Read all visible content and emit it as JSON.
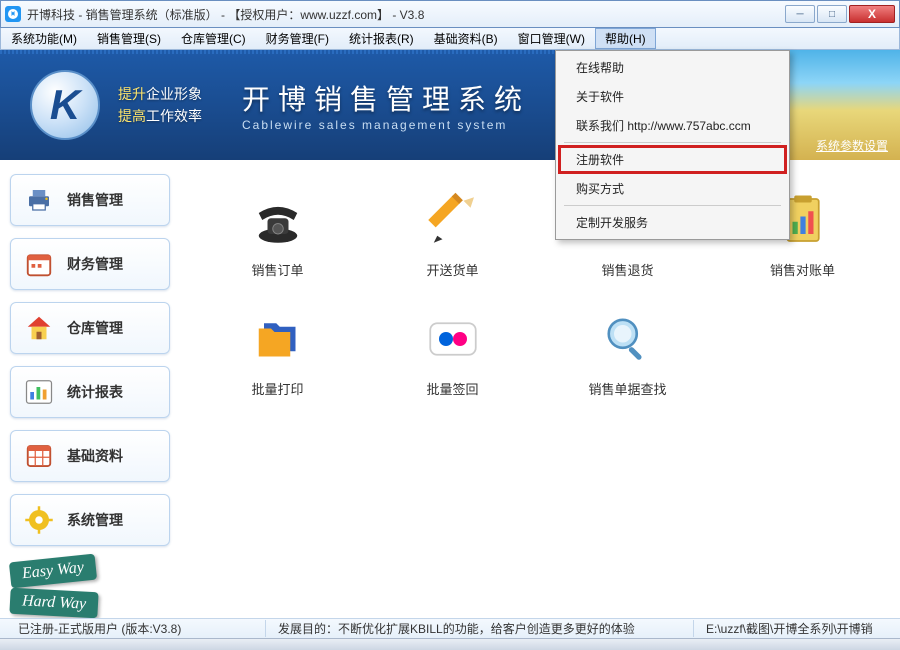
{
  "window": {
    "title": "开博科技 - 销售管理系统（标准版） - 【授权用户：www.uzzf.com】 - V3.8"
  },
  "menu": {
    "items": [
      {
        "label": "系统功能(M)"
      },
      {
        "label": "销售管理(S)"
      },
      {
        "label": "仓库管理(C)"
      },
      {
        "label": "财务管理(F)"
      },
      {
        "label": "统计报表(R)"
      },
      {
        "label": "基础资料(B)"
      },
      {
        "label": "窗口管理(W)"
      },
      {
        "label": "帮助(H)"
      }
    ]
  },
  "banner": {
    "logo_letter": "K",
    "slogan_l1": "提升企业形象",
    "slogan_l2": "提高工作效率",
    "title_cn": "开博销售管理系统",
    "title_en": "Cablewire sales management system",
    "param_link": "系统参数设置"
  },
  "sidebar": {
    "items": [
      {
        "label": "销售管理",
        "icon": "printer"
      },
      {
        "label": "财务管理",
        "icon": "calendar-money"
      },
      {
        "label": "仓库管理",
        "icon": "house"
      },
      {
        "label": "统计报表",
        "icon": "bar-chart"
      },
      {
        "label": "基础资料",
        "icon": "grid-data"
      },
      {
        "label": "系统管理",
        "icon": "gear"
      }
    ],
    "sign1": "Easy Way",
    "sign2": "Hard Way"
  },
  "grid": {
    "items": [
      {
        "label": "销售订单",
        "icon": "phone"
      },
      {
        "label": "开送货单",
        "icon": "pencil"
      },
      {
        "label": "销售退货",
        "icon": "return-box"
      },
      {
        "label": "销售对账单",
        "icon": "clipboard-chart"
      },
      {
        "label": "批量打印",
        "icon": "folders"
      },
      {
        "label": "批量签回",
        "icon": "flickr"
      },
      {
        "label": "销售单据查找",
        "icon": "magnifier"
      }
    ]
  },
  "dropdown": {
    "items": [
      {
        "label": "在线帮助"
      },
      {
        "label": "关于软件"
      },
      {
        "label": "联系我们  http://www.757abc.ccm"
      },
      {
        "label": "注册软件",
        "highlight": true
      },
      {
        "label": "购买方式"
      },
      {
        "label": "定制开发服务"
      }
    ]
  },
  "status": {
    "left": "已注册-正式版用户 (版本:V3.8)",
    "center": "发展目的：不断优化扩展KBILL的功能，给客户创造更多更好的体验",
    "right": "E:\\uzzf\\截图\\开博全系列\\开博销"
  }
}
